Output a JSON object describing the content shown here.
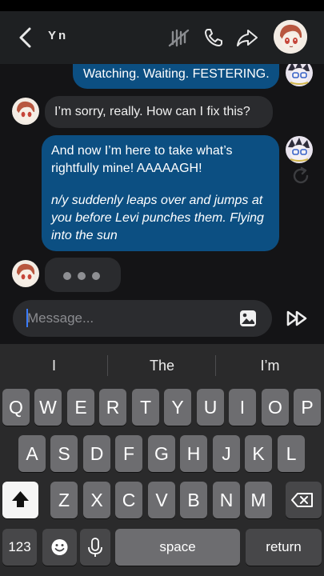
{
  "header": {
    "title": "Yn"
  },
  "messages": {
    "m1": "Watching. Waiting. FESTERING.",
    "m2": "I’m sorry, really. How can I fix this?",
    "m3_speech": "And now I’m here to take what’s rightfully mine! AAAAAGH!",
    "m3_action": "n/y suddenly leaps over and jumps at you before Levi punches them. Flying into the sun"
  },
  "composer": {
    "placeholder": "Message..."
  },
  "keyboard": {
    "suggestions": [
      "I",
      "The",
      "I’m"
    ],
    "row1": [
      "Q",
      "W",
      "E",
      "R",
      "T",
      "Y",
      "U",
      "I",
      "O",
      "P"
    ],
    "row2": [
      "A",
      "S",
      "D",
      "F",
      "G",
      "H",
      "J",
      "K",
      "L"
    ],
    "row3": [
      "Z",
      "X",
      "C",
      "V",
      "B",
      "N",
      "M"
    ],
    "numbers_label": "123",
    "space_label": "space",
    "return_label": "return"
  },
  "colors": {
    "outgoing_bubble": "#0c4f82",
    "incoming_bubble": "#2a2b2e",
    "caret": "#3a7cff"
  },
  "icons": [
    "back-arrow",
    "mute-icon",
    "phone-icon",
    "share-icon",
    "image-icon",
    "send-icon",
    "regenerate-icon",
    "shift-icon",
    "backspace-icon",
    "emoji-icon",
    "mic-icon"
  ]
}
